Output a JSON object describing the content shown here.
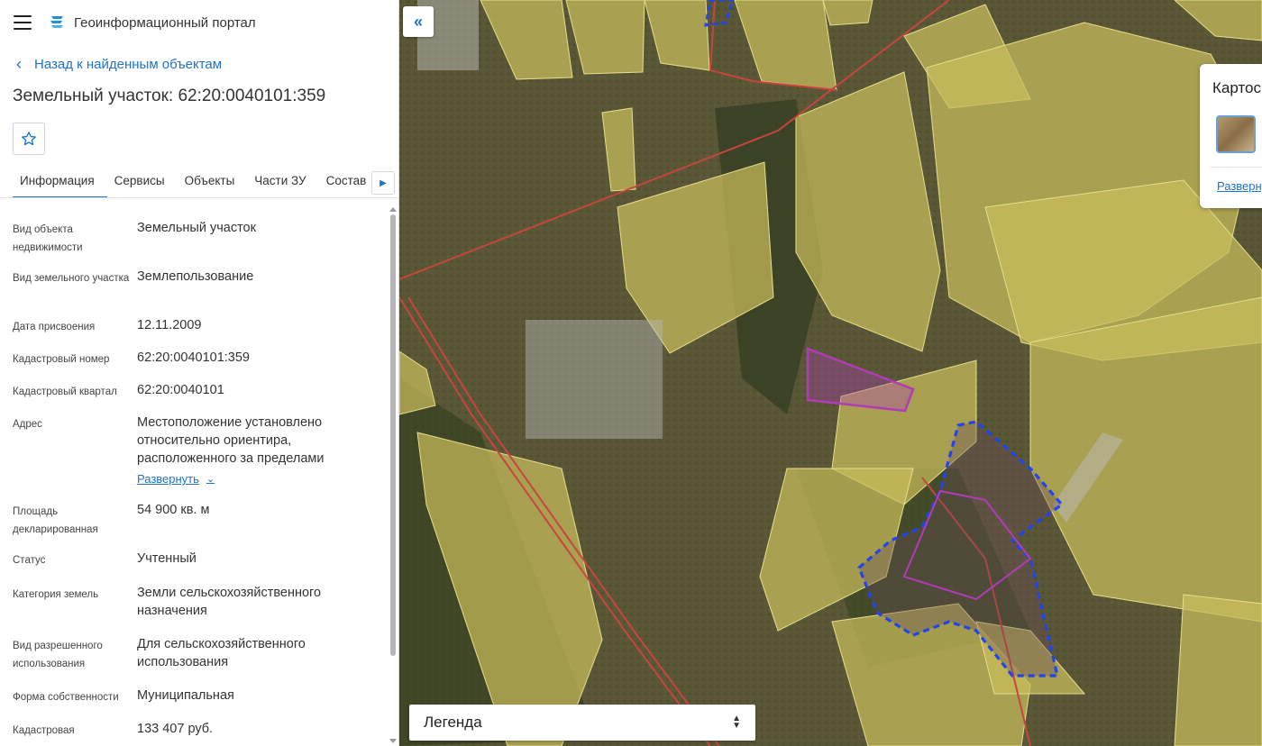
{
  "header": {
    "app_title": "Геоинформационный портал",
    "menu_icon": "hamburger-menu-icon",
    "logo_icon": "portal-logo-icon"
  },
  "nav": {
    "back_label": "Назад к найденным объектам"
  },
  "object": {
    "title": "Земельный участок: 62:20:0040101:359",
    "favorite_icon": "star-icon"
  },
  "tabs": [
    {
      "label": "Информация",
      "active": true
    },
    {
      "label": "Сервисы",
      "active": false
    },
    {
      "label": "Объекты",
      "active": false
    },
    {
      "label": "Части ЗУ",
      "active": false
    },
    {
      "label": "Состав",
      "active": false
    }
  ],
  "info": [
    {
      "label": "Вид объекта недвижимости",
      "value": "Земельный участок"
    },
    {
      "label": "Вид земельного участка",
      "value": "Землепользование"
    },
    {
      "label": "Дата присвоения",
      "value": "12.11.2009"
    },
    {
      "label": "Кадастровый номер",
      "value": "62:20:0040101:359"
    },
    {
      "label": "Кадастровый квартал",
      "value": "62:20:0040101"
    },
    {
      "label": "Адрес",
      "value": "Местоположение установлено относительно ориентира, расположенного за пределами",
      "expand_label": "Развернуть"
    },
    {
      "label": "Площадь декларированная",
      "value": "54 900 кв. м"
    },
    {
      "label": "Статус",
      "value": "Учтенный"
    },
    {
      "label": "Категория земель",
      "value": "Земли сельскохозяйственного назначения"
    },
    {
      "label": "Вид разрешенного использования",
      "value": "Для сельскохозяйственного использования"
    },
    {
      "label": "Форма собственности",
      "value": "Муниципальная"
    },
    {
      "label": "Кадастровая",
      "value": "133 407 руб."
    }
  ],
  "map": {
    "legend_label": "Легенда",
    "card_title": "Картос",
    "card_link": "Развернуть",
    "colors": {
      "parcel_fill": "#c9bd5c",
      "selected_parcel": "#b03cb8",
      "boundary_blue": "#2244ee",
      "road_red": "#c8453f",
      "accent": "#1f73c8"
    }
  }
}
